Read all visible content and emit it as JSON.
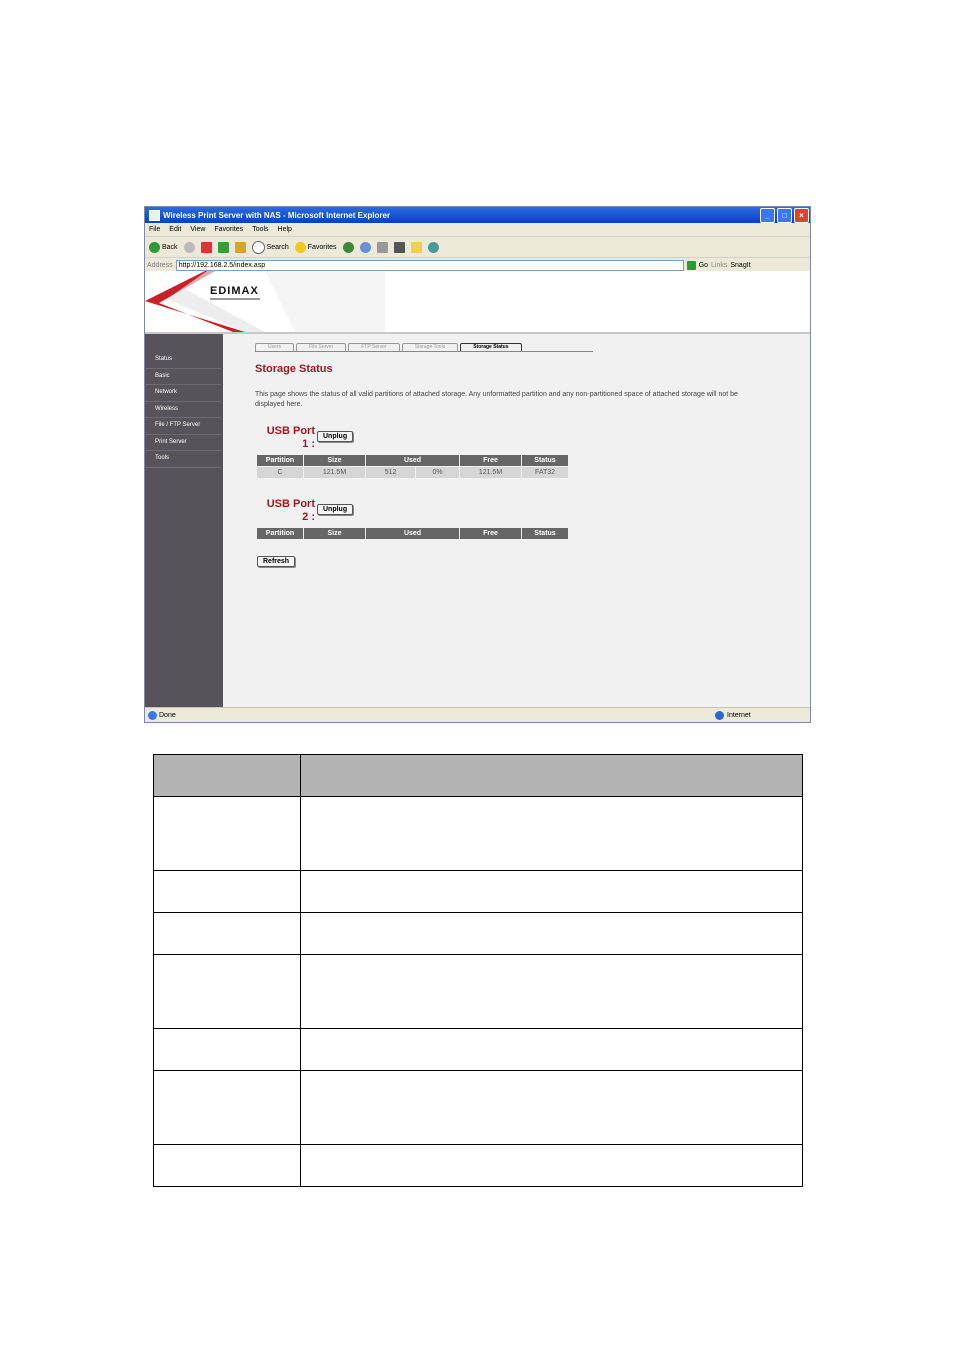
{
  "window": {
    "title": "Wireless Print Server with NAS - Microsoft Internet Explorer",
    "controls": {
      "minimize": "_",
      "maximize": "□",
      "close": "×"
    }
  },
  "menu": [
    "File",
    "Edit",
    "View",
    "Favorites",
    "Tools",
    "Help"
  ],
  "toolbar": {
    "back": "Back",
    "search": "Search",
    "favorites": "Favorites"
  },
  "address": {
    "label": "Address",
    "url": "http://192.168.2.5/index.asp",
    "go": "Go",
    "links": "Links",
    "snagit": "SnagIt"
  },
  "brand": {
    "logo": "EDIMAX"
  },
  "sidebar": {
    "items": [
      "Status",
      "Basic",
      "Network",
      "Wireless",
      "File / FTP Server",
      "Print Server",
      "Tools"
    ]
  },
  "tabs": [
    "Users",
    "File Server",
    "FTP Server",
    "Storage Tools",
    "Storage Status"
  ],
  "main": {
    "title": "Storage Status",
    "description": "This page shows the status of all valid partitions of attached storage. Any unformatted partition and any non-partitioned space of attached storage will not be displayed here."
  },
  "ports": [
    {
      "label": "USB Port",
      "number": "1 :",
      "button": "Unplug"
    },
    {
      "label": "USB Port",
      "number": "2 :",
      "button": "Unplug"
    }
  ],
  "table_headers": [
    "Partition",
    "Size",
    "Used",
    "Free",
    "Status"
  ],
  "port1_row": [
    "C",
    "121.5M",
    "512",
    "0%",
    "121.5M",
    "FAT32"
  ],
  "refresh_label": "Refresh",
  "statusbar": {
    "left": "Done",
    "zone": "Internet"
  },
  "colors": {
    "accent": "#a0191e",
    "sidebar": "#58535a",
    "header": "#666666",
    "ie_title": "#0a3fbf"
  }
}
